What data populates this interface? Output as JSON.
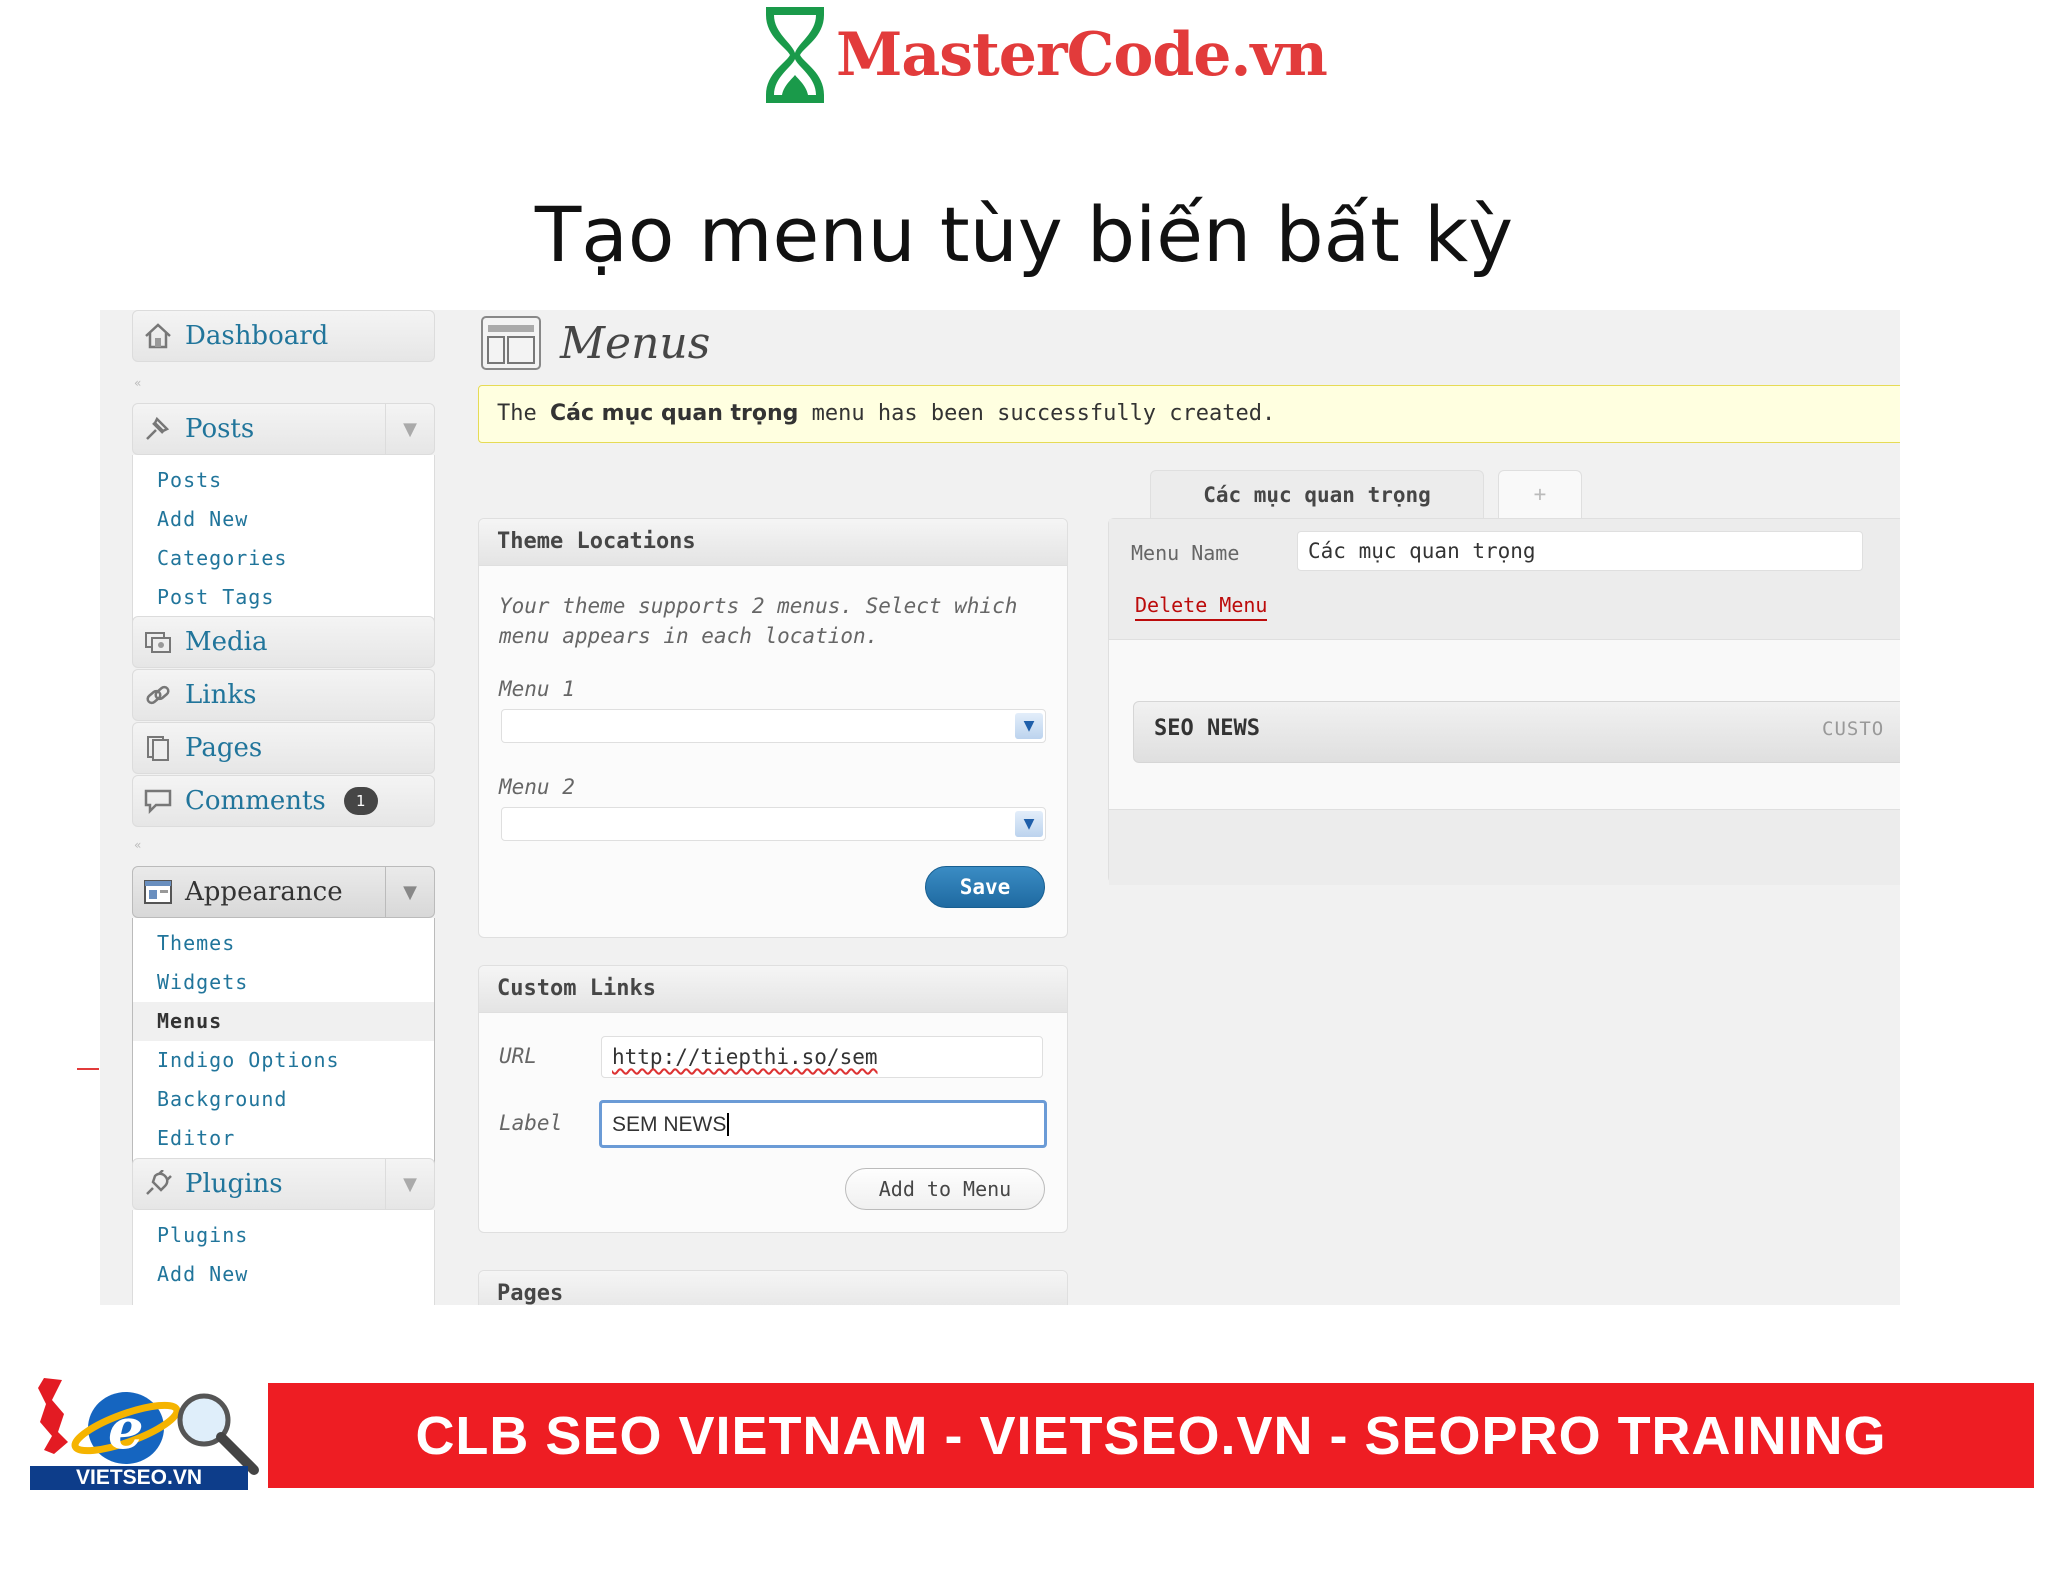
{
  "header": {
    "logo_text": "MasterCode.vn",
    "slide_title": "Tạo menu tùy biến bất kỳ"
  },
  "sidebar": {
    "dashboard": "Dashboard",
    "posts": {
      "label": "Posts",
      "items": [
        "Posts",
        "Add New",
        "Categories",
        "Post Tags"
      ]
    },
    "media": "Media",
    "links": "Links",
    "pages": "Pages",
    "comments": {
      "label": "Comments",
      "count": "1"
    },
    "appearance": {
      "label": "Appearance",
      "items": [
        "Themes",
        "Widgets",
        "Menus",
        "Indigo Options",
        "Background",
        "Editor"
      ],
      "current": "Menus"
    },
    "plugins": {
      "label": "Plugins",
      "items": [
        "Plugins",
        "Add New"
      ]
    }
  },
  "main": {
    "title": "Menus",
    "notice": {
      "before": "The ",
      "menu": "Các mục quan trọng",
      "after": " menu has been successfully created."
    },
    "theme_locations": {
      "heading": "Theme Locations",
      "description": "Your theme supports 2 menus. Select which menu appears in each location.",
      "menu1_label": "Menu 1",
      "menu2_label": "Menu 2",
      "save": "Save"
    },
    "custom_links": {
      "heading": "Custom Links",
      "url_label": "URL",
      "url_value": "http://tiepthi.so/sem",
      "label_label": "Label",
      "label_value": "SEM NEWS",
      "add_button": "Add to Menu"
    },
    "pages_heading": "Pages",
    "editor": {
      "tab_active": "Các mục quan trọng",
      "tab_add": "+",
      "menu_name_label": "Menu Name",
      "menu_name_value": "Các mục quan trọng",
      "delete": "Delete Menu",
      "item_title": "SEO NEWS",
      "item_type": "CUSTO"
    }
  },
  "footer": {
    "logo_text": "VIETSEO.VN",
    "banner": "CLB SEO VIETNAM - VIETSEO.VN - SEOPRO TRAINING"
  },
  "colors": {
    "link": "#21759b",
    "notice_bg": "#ffffe0",
    "banner_red": "#ee1d23",
    "logo_red": "#e23b3b",
    "logo_green": "#1a9a4a"
  }
}
